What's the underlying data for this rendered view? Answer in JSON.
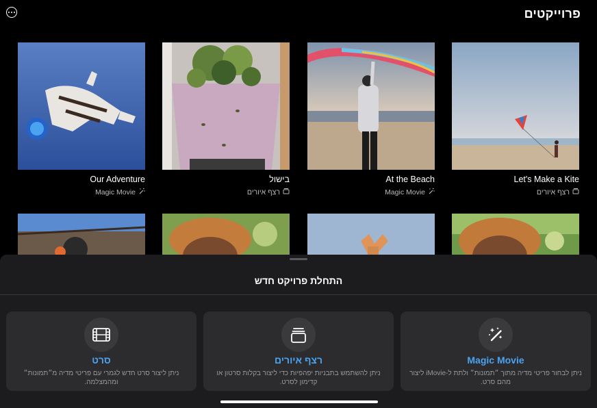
{
  "header": {
    "title": "פרוייקטים",
    "more_icon": "ellipsis-circle-icon"
  },
  "projects": [
    {
      "title": "Let's Make a Kite",
      "type_label": "רצף איורים",
      "type_icon": "storyboard-icon"
    },
    {
      "title": "At the Beach",
      "type_label": "Magic Movie",
      "type_icon": "magic-wand-icon"
    },
    {
      "title": "בישול",
      "type_label": "רצף איורים",
      "type_icon": "storyboard-icon"
    },
    {
      "title": "Our Adventure",
      "type_label": "Magic Movie",
      "type_icon": "magic-wand-icon"
    }
  ],
  "sheet": {
    "title": "התחלת פרויקט חדש",
    "options": [
      {
        "label": "Magic Movie",
        "description": "ניתן לבחור פריטי מדיה מתוך ״תמונות״ ולתת ל‑iMovie ליצור מהם סרט.",
        "icon": "magic-wand-icon"
      },
      {
        "label": "רצף איורים",
        "description": "ניתן להשתמש בתבניות יפהפיות כדי ליצור בקלות סרטון או קדימון לסרט.",
        "icon": "storyboard-icon"
      },
      {
        "label": "סרט",
        "description": "ניתן ליצור סרט חדש לגמרי עם פריטי מדיה מ״תמונות״ ומהמצלמה.",
        "icon": "film-icon"
      }
    ]
  },
  "colors": {
    "accent": "#4aa3f0",
    "sheet_bg": "#1c1c1e",
    "card_bg": "#2c2c2e"
  }
}
